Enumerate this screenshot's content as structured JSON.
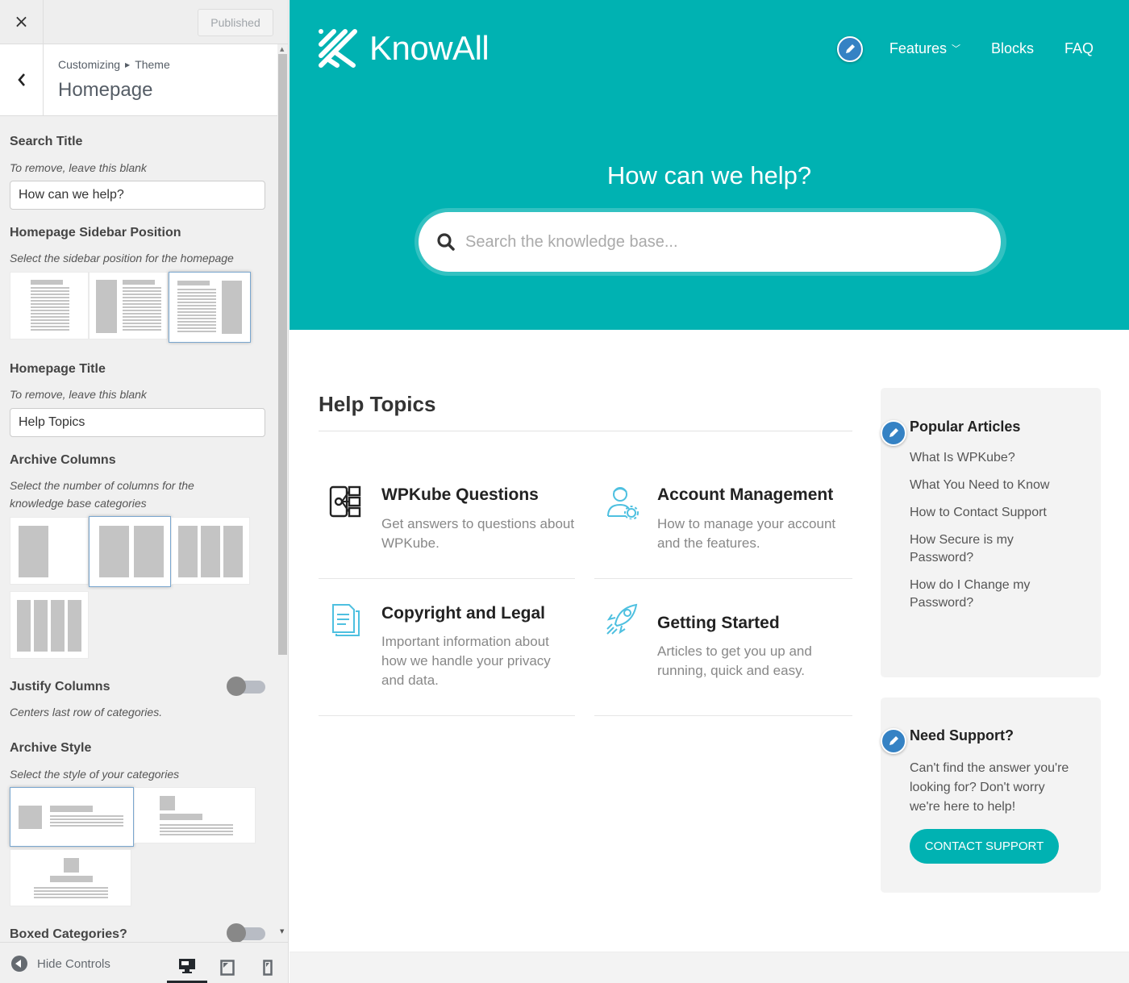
{
  "customizer": {
    "close_label": "×",
    "publish_button": "Published",
    "breadcrumb": {
      "root": "Customizing",
      "parent": "Theme"
    },
    "section_title": "Homepage",
    "search_title": {
      "label": "Search Title",
      "description": "To remove, leave this blank",
      "value": "How can we help?"
    },
    "sidebar_position": {
      "label": "Homepage Sidebar Position",
      "description": "Select the sidebar position for the homepage",
      "options": [
        "no-sidebar",
        "left-sidebar",
        "right-sidebar"
      ],
      "selected": "right-sidebar"
    },
    "homepage_title": {
      "label": "Homepage Title",
      "description": "To remove, leave this blank",
      "value": "Help Topics"
    },
    "archive_columns": {
      "label": "Archive Columns",
      "description": "Select the number of columns for the knowledge base categories",
      "options": [
        1,
        2,
        3,
        4
      ],
      "selected": 2
    },
    "justify_columns": {
      "label": "Justify Columns",
      "description": "Centers last row of categories.",
      "enabled": false
    },
    "archive_style": {
      "label": "Archive Style",
      "description": "Select the style of your categories",
      "options": [
        "icon-left",
        "icon-top-left",
        "icon-top-center"
      ],
      "selected": "icon-left"
    },
    "boxed_categories": {
      "label": "Boxed Categories?",
      "enabled": false
    },
    "footer": {
      "hide_controls": "Hide Controls",
      "devices": [
        "desktop",
        "tablet",
        "mobile"
      ],
      "active_device": "desktop"
    }
  },
  "preview": {
    "brand": {
      "name": "KnowAll",
      "color": "#00b2b2"
    },
    "nav": [
      {
        "label": "Features",
        "has_dropdown": true
      },
      {
        "label": "Blocks",
        "has_dropdown": false
      },
      {
        "label": "FAQ",
        "has_dropdown": false
      }
    ],
    "hero": {
      "title": "How can we help?",
      "search_placeholder": "Search the knowledge base..."
    },
    "help_topics": {
      "title": "Help Topics",
      "topics": [
        {
          "title": "WPKube Questions",
          "description": "Get answers to questions about WPKube.",
          "icon": "mobile-sitemap-icon"
        },
        {
          "title": "Account Management",
          "description": "How to manage your account and the features.",
          "icon": "user-gear-icon"
        },
        {
          "title": "Copyright and Legal",
          "description": "Important information about how we handle your privacy and data.",
          "icon": "document-icon"
        },
        {
          "title": "Getting Started",
          "description": "Articles to get you up and running, quick and easy.",
          "icon": "rocket-icon"
        }
      ]
    },
    "popular_articles": {
      "title": "Popular Articles",
      "items": [
        "What Is WPKube?",
        "What You Need to Know",
        "How to Contact Support",
        "How Secure is my Password?",
        "How do I Change my Password?"
      ]
    },
    "need_support": {
      "title": "Need Support?",
      "text": "Can't find the answer you're looking for? Don't worry we're here to help!",
      "button": "CONTACT SUPPORT"
    }
  }
}
